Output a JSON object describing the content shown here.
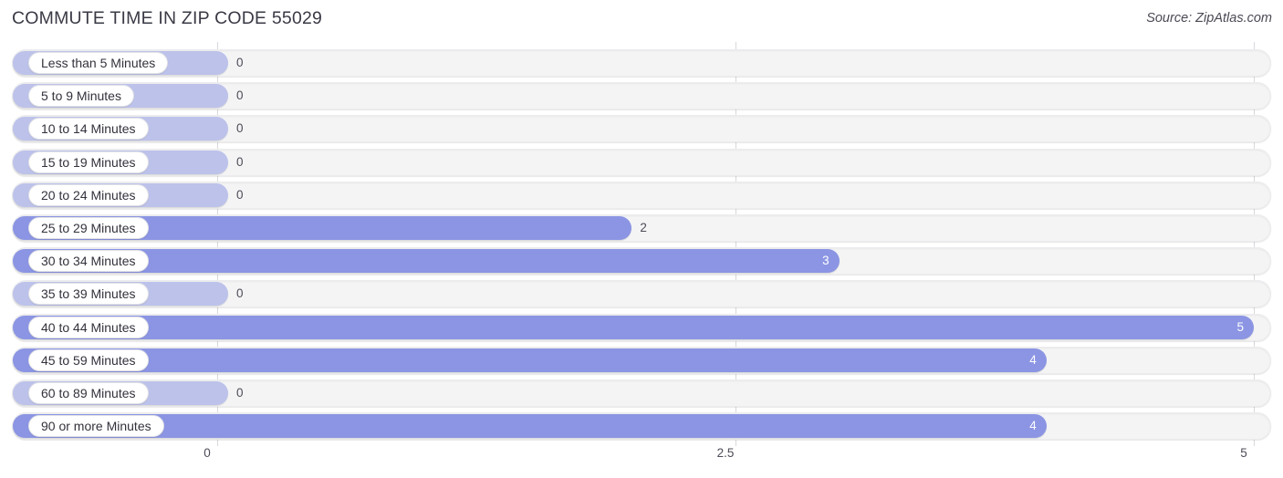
{
  "header": {
    "title": "COMMUTE TIME IN ZIP CODE 55029",
    "source": "Source: ZipAtlas.com"
  },
  "chart_data": {
    "type": "bar",
    "orientation": "horizontal",
    "title": "COMMUTE TIME IN ZIP CODE 55029",
    "subtitle": "",
    "xlabel": "",
    "ylabel": "",
    "xlim": [
      0,
      5
    ],
    "ticks": [
      "0",
      "2.5",
      "5"
    ],
    "tick_values": [
      0,
      2.5,
      5
    ],
    "grid": true,
    "legend": false,
    "categories": [
      "Less than 5 Minutes",
      "5 to 9 Minutes",
      "10 to 14 Minutes",
      "15 to 19 Minutes",
      "20 to 24 Minutes",
      "25 to 29 Minutes",
      "30 to 34 Minutes",
      "35 to 39 Minutes",
      "40 to 44 Minutes",
      "45 to 59 Minutes",
      "60 to 89 Minutes",
      "90 or more Minutes"
    ],
    "values": [
      0,
      0,
      0,
      0,
      0,
      2,
      3,
      0,
      5,
      4,
      0,
      4
    ],
    "value_labels": [
      "0",
      "0",
      "0",
      "0",
      "0",
      "2",
      "3",
      "0",
      "5",
      "4",
      "0",
      "4"
    ],
    "colors": {
      "bar": "#8b95e3",
      "bar_zero": "#bcc2ea",
      "track": "#f4f4f5",
      "gridline": "#d9d9de",
      "label_pill": "#ffffff",
      "value_inside": "#ffffff",
      "value_outside": "#4c4c57",
      "title": "#3a3a46"
    }
  }
}
